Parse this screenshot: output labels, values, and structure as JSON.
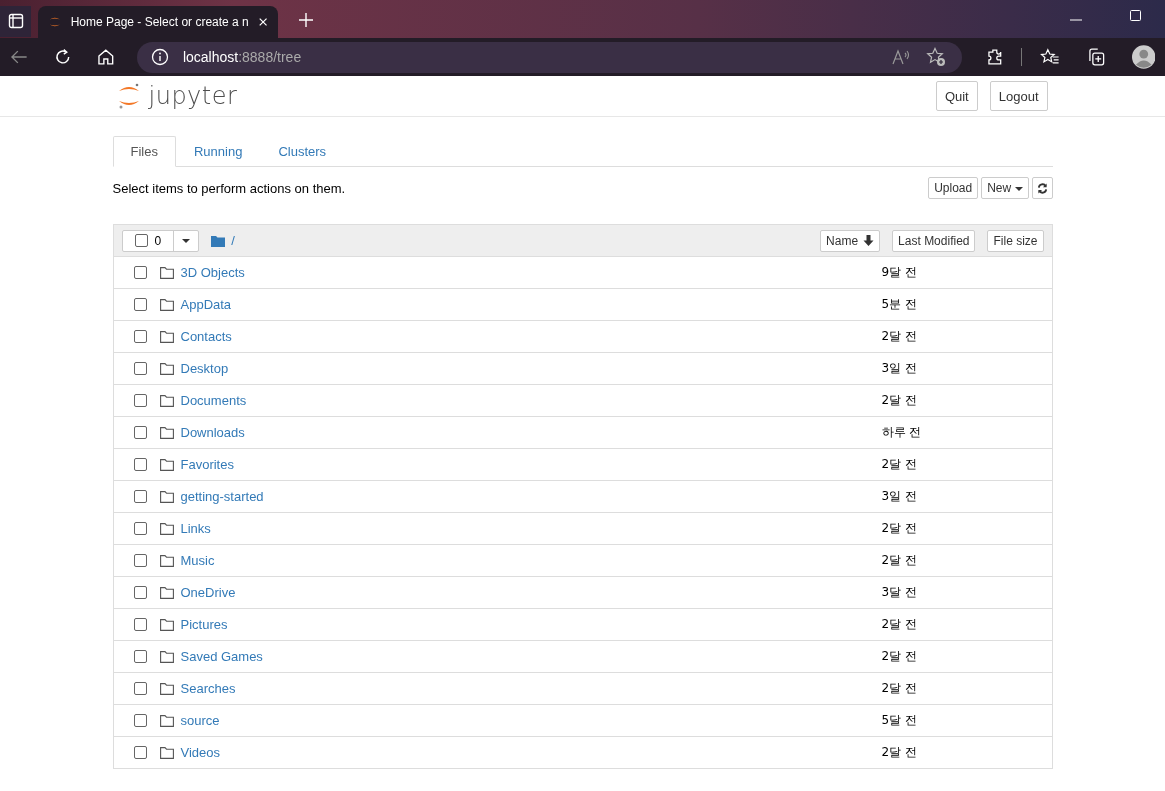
{
  "browser": {
    "tab_title": "Home Page - Select or create a n",
    "url_host": "localhost",
    "url_path": ":8888/tree"
  },
  "header": {
    "logo_text": "jupyter",
    "buttons": [
      "Quit",
      "Logout"
    ]
  },
  "tabs": [
    {
      "label": "Files",
      "selected": true
    },
    {
      "label": "Running",
      "selected": false
    },
    {
      "label": "Clusters",
      "selected": false
    }
  ],
  "toolbar": {
    "hint": "Select items to perform actions on them.",
    "upload": "Upload",
    "new": "New"
  },
  "list_header": {
    "selected_count": "0",
    "checked": false,
    "path": "/",
    "sort_buttons": [
      "Name",
      "Last Modified",
      "File size"
    ]
  },
  "items": [
    {
      "name": "3D Objects",
      "modified": "9달 전",
      "checked": false
    },
    {
      "name": "AppData",
      "modified": "5분 전",
      "checked": false
    },
    {
      "name": "Contacts",
      "modified": "2달 전",
      "checked": false
    },
    {
      "name": "Desktop",
      "modified": "3일 전",
      "checked": false
    },
    {
      "name": "Documents",
      "modified": "2달 전",
      "checked": false
    },
    {
      "name": "Downloads",
      "modified": "하루 전",
      "checked": false
    },
    {
      "name": "Favorites",
      "modified": "2달 전",
      "checked": false
    },
    {
      "name": "getting-started",
      "modified": "3일 전",
      "checked": false
    },
    {
      "name": "Links",
      "modified": "2달 전",
      "checked": false
    },
    {
      "name": "Music",
      "modified": "2달 전",
      "checked": false
    },
    {
      "name": "OneDrive",
      "modified": "3달 전",
      "checked": false
    },
    {
      "name": "Pictures",
      "modified": "2달 전",
      "checked": false
    },
    {
      "name": "Saved Games",
      "modified": "2달 전",
      "checked": false
    },
    {
      "name": "Searches",
      "modified": "2달 전",
      "checked": false
    },
    {
      "name": "source",
      "modified": "5달 전",
      "checked": false
    },
    {
      "name": "Videos",
      "modified": "2달 전",
      "checked": false
    }
  ]
}
